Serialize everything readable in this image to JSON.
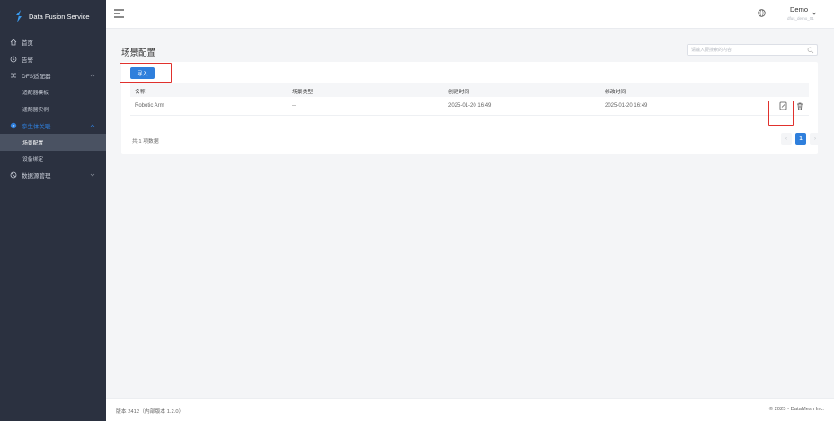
{
  "app": {
    "title": "Data Fusion Service"
  },
  "sidebar": {
    "items": [
      {
        "label": "首页",
        "icon": "home-icon"
      },
      {
        "label": "告警",
        "icon": "alarm-icon"
      },
      {
        "label": "DFS适配器",
        "icon": "shuffle-icon"
      },
      {
        "label": "适配器模板"
      },
      {
        "label": "适配器实例"
      },
      {
        "label": "孪生体关联",
        "icon": "link-icon"
      },
      {
        "label": "场景配置"
      },
      {
        "label": "设备绑定"
      },
      {
        "label": "数据源管理",
        "icon": "database-icon"
      }
    ]
  },
  "topbar": {
    "user_name": "Demo",
    "user_sub": "dfus_demo_01"
  },
  "page": {
    "title": "场景配置",
    "search_placeholder": "请输入要搜索的内容"
  },
  "toolbar": {
    "import_label": "导入"
  },
  "table": {
    "headers": [
      "名称",
      "场景类型",
      "创建时间",
      "修改时间"
    ],
    "rows": [
      [
        "Robotic Arm",
        "--",
        "2025-01-20 16:49",
        "2025-01-20 16:49"
      ]
    ]
  },
  "pagination": {
    "total_text": "共 1 项数据",
    "current_page": "1",
    "prev": "‹",
    "next": "›"
  },
  "footer": {
    "version": "版本 2412（内部版本 1.2.0）",
    "copyright": "© 2025 - DataMesh Inc."
  },
  "colors": {
    "accent": "#2f7fdc",
    "sidebar_bg": "#2b3140",
    "highlight": "#e0312d"
  }
}
